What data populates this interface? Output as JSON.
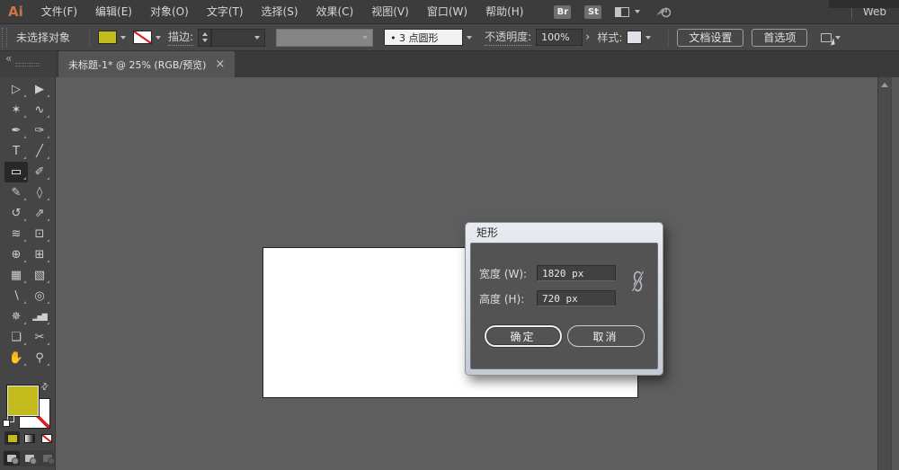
{
  "app": {
    "logo_text": "Ai",
    "workspace_label": "Web"
  },
  "menu_bar": {
    "items": [
      "文件(F)",
      "编辑(E)",
      "对象(O)",
      "文字(T)",
      "选择(S)",
      "效果(C)",
      "视图(V)",
      "窗口(W)",
      "帮助(H)"
    ],
    "bridge_button": "Br",
    "stock_button": "St"
  },
  "options_bar": {
    "status_text": "未选择对象",
    "fill_color": "#c3ba1e",
    "stroke_label": "描边:",
    "brush_value": "•  3 点圆形",
    "opacity_label": "不透明度:",
    "opacity_value": "100%",
    "expand_glyph": "›",
    "style_label": "样式:",
    "document_setup_button": "文档设置",
    "preferences_button": "首选项"
  },
  "document_tab": {
    "title": "未标题-1* @ 25% (RGB/预览)",
    "close_glyph": "×"
  },
  "toolbar": {
    "collapse_glyph": "«",
    "swap_glyph": "⇄",
    "tools": [
      {
        "name": "selection",
        "glyph": "▷"
      },
      {
        "name": "direct-selection",
        "glyph": "▶"
      },
      {
        "name": "magic-wand",
        "glyph": "✶"
      },
      {
        "name": "lasso",
        "glyph": "∿"
      },
      {
        "name": "pen",
        "glyph": "✒"
      },
      {
        "name": "curvature",
        "glyph": "✑"
      },
      {
        "name": "type",
        "glyph": "T"
      },
      {
        "name": "line-segment",
        "glyph": "╱"
      },
      {
        "name": "rectangle",
        "glyph": "▭",
        "selected": true
      },
      {
        "name": "paintbrush",
        "glyph": "✐"
      },
      {
        "name": "pencil",
        "glyph": "✎"
      },
      {
        "name": "eraser",
        "glyph": "◊"
      },
      {
        "name": "rotate",
        "glyph": "↺"
      },
      {
        "name": "scale",
        "glyph": "⇗"
      },
      {
        "name": "width",
        "glyph": "≋"
      },
      {
        "name": "free-transform",
        "glyph": "⊡"
      },
      {
        "name": "shape-builder",
        "glyph": "⊕"
      },
      {
        "name": "perspective-grid",
        "glyph": "⊞"
      },
      {
        "name": "mesh",
        "glyph": "▦"
      },
      {
        "name": "gradient",
        "glyph": "▧"
      },
      {
        "name": "eyedropper",
        "glyph": "∖"
      },
      {
        "name": "blend",
        "glyph": "◎"
      },
      {
        "name": "symbol-sprayer",
        "glyph": "✵"
      },
      {
        "name": "column-graph",
        "glyph": "▂▅▇",
        "small": true
      },
      {
        "name": "artboard",
        "glyph": "❏"
      },
      {
        "name": "slice",
        "glyph": "✂"
      },
      {
        "name": "hand",
        "glyph": "✋"
      },
      {
        "name": "zoom",
        "glyph": "⚲"
      }
    ]
  },
  "dialog": {
    "title": "矩形",
    "width_label": "宽度 (W):",
    "width_value": "1820 px",
    "height_label": "高度 (H):",
    "height_value": "720 px",
    "ok_button": "确定",
    "cancel_button": "取消"
  }
}
